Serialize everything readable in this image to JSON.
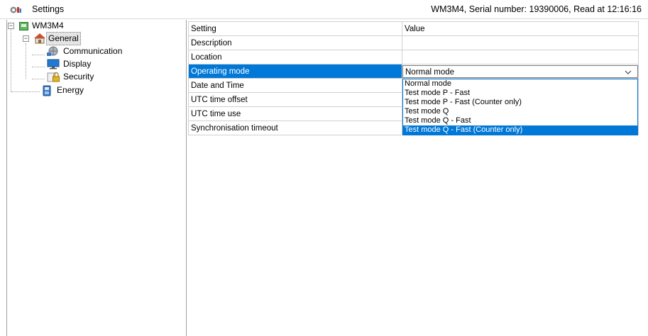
{
  "window": {
    "title": "Settings",
    "status": "WM3M4, Serial number: 19390006, Read at 12:16:16"
  },
  "tree": {
    "root": "WM3M4",
    "general": "General",
    "communication": "Communication",
    "display": "Display",
    "security": "Security",
    "energy": "Energy"
  },
  "grid": {
    "headers": {
      "setting": "Setting",
      "value": "Value"
    },
    "rows": [
      {
        "setting": "Description",
        "value": ""
      },
      {
        "setting": "Location",
        "value": ""
      },
      {
        "setting": "Operating mode",
        "value": "Normal mode"
      },
      {
        "setting": "Date and Time",
        "value": ""
      },
      {
        "setting": "UTC time offset",
        "value": ""
      },
      {
        "setting": "UTC time use",
        "value": ""
      },
      {
        "setting": "Synchronisation timeout",
        "value": ""
      }
    ]
  },
  "dropdown": {
    "options": [
      "Normal mode",
      "Test mode P - Fast",
      "Test mode P - Fast (Counter only)",
      "Test mode Q",
      "Test mode Q - Fast",
      "Test mode Q - Fast (Counter only)"
    ]
  },
  "colors": {
    "selection": "#0078d7"
  }
}
